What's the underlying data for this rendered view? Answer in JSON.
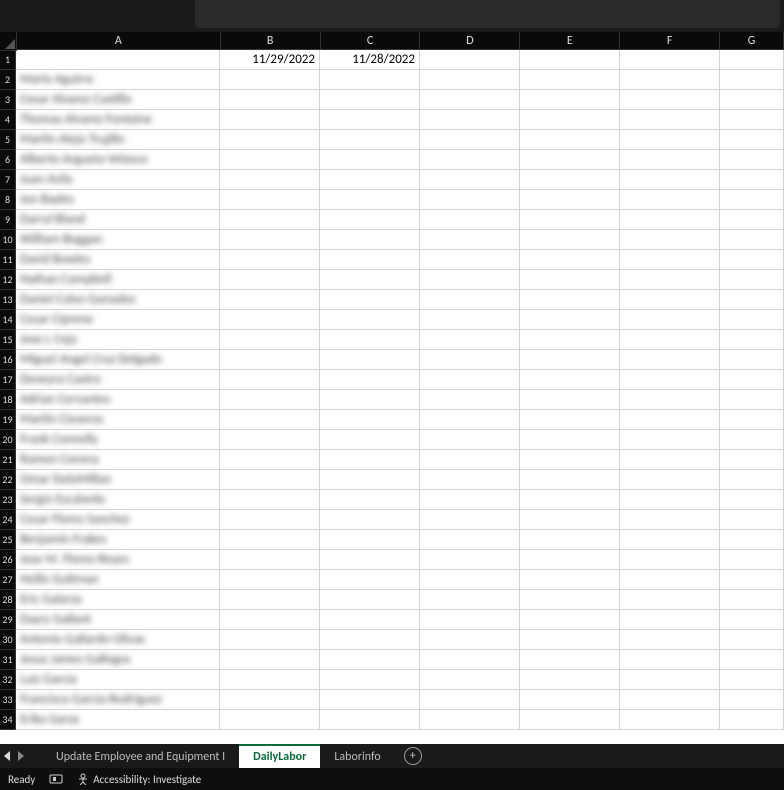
{
  "columns": [
    "A",
    "B",
    "C",
    "D",
    "E",
    "F",
    "G"
  ],
  "header_row": {
    "B": "11/29/2022",
    "C": "11/28/2022"
  },
  "first_row_number": 1,
  "names": [
    "Mario Aguirre",
    "Cesar Alvarez Castillo",
    "Thomas Alvarez Fontaine",
    "Martin Alejo Trujillo",
    "Alberto Argueta-Velasco",
    "Juan Avila",
    "Jon Bayles",
    "Darryl Bland",
    "William Boggan",
    "David Bowles",
    "Nathan Campbell",
    "Daniel Calvo Gonzalez",
    "Cesar Ciprene",
    "Jose L Ceja",
    "Miguel Angel Cruz Delgado",
    "Deneyra Castro",
    "Adrian Cervantes",
    "Martin Cisneros",
    "Frank Connelly",
    "Ramon Corona",
    "Omar DaSsMillan",
    "Sergio Escalante",
    "Cesar Flores Sanchez",
    "Benjamin Frakes",
    "Jose M. Flores-Reyes",
    "Hollis Guttman",
    "Eric Galarza",
    "Dayry Gallant",
    "Antonio Gallardo-Olivas",
    "Jesus James Gallegos",
    "Luis Garcia",
    "Francisco Garcia-Rodriguez",
    "Erika Garza"
  ],
  "sheet_tabs": {
    "prev": "Update Employee and Equipment I",
    "active": "DailyLabor",
    "next": "Laborinfo"
  },
  "status_bar": {
    "ready": "Ready",
    "accessibility": "Accessibility: Investigate"
  }
}
